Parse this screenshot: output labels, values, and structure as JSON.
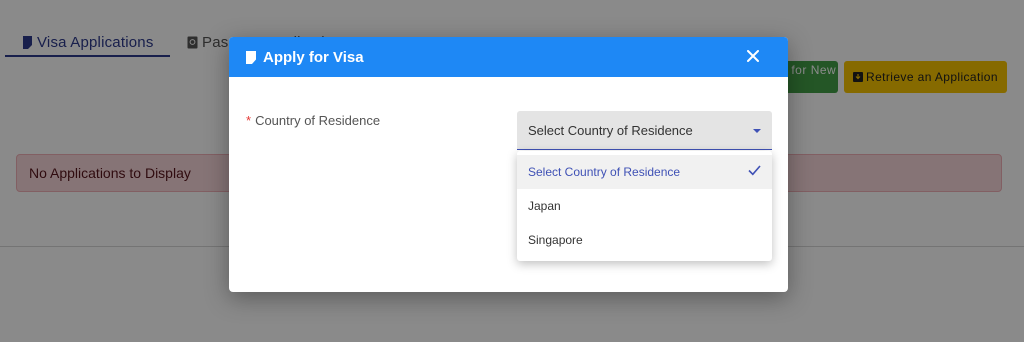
{
  "tabs": {
    "visa_label": "Visa Applications",
    "passport_label": "Passport Applications"
  },
  "toolbar": {
    "new_visa_label": "Apply for New Visa",
    "retrieve_label": "Retrieve an Application"
  },
  "alert": {
    "text": "No Applications to Display"
  },
  "modal": {
    "title": "Apply for Visa",
    "field": {
      "required_marker": "*",
      "label": "Country of Residence",
      "selected_value": "Select Country of Residence",
      "options": [
        "Select Country of Residence",
        "Japan",
        "Singapore"
      ]
    }
  },
  "colors": {
    "primary_blue": "#1e88f5",
    "indigo_accent": "#3f51b5",
    "green_button": "#43a047",
    "yellow_button": "#f7c400",
    "alert_bg": "#f8d7da"
  }
}
